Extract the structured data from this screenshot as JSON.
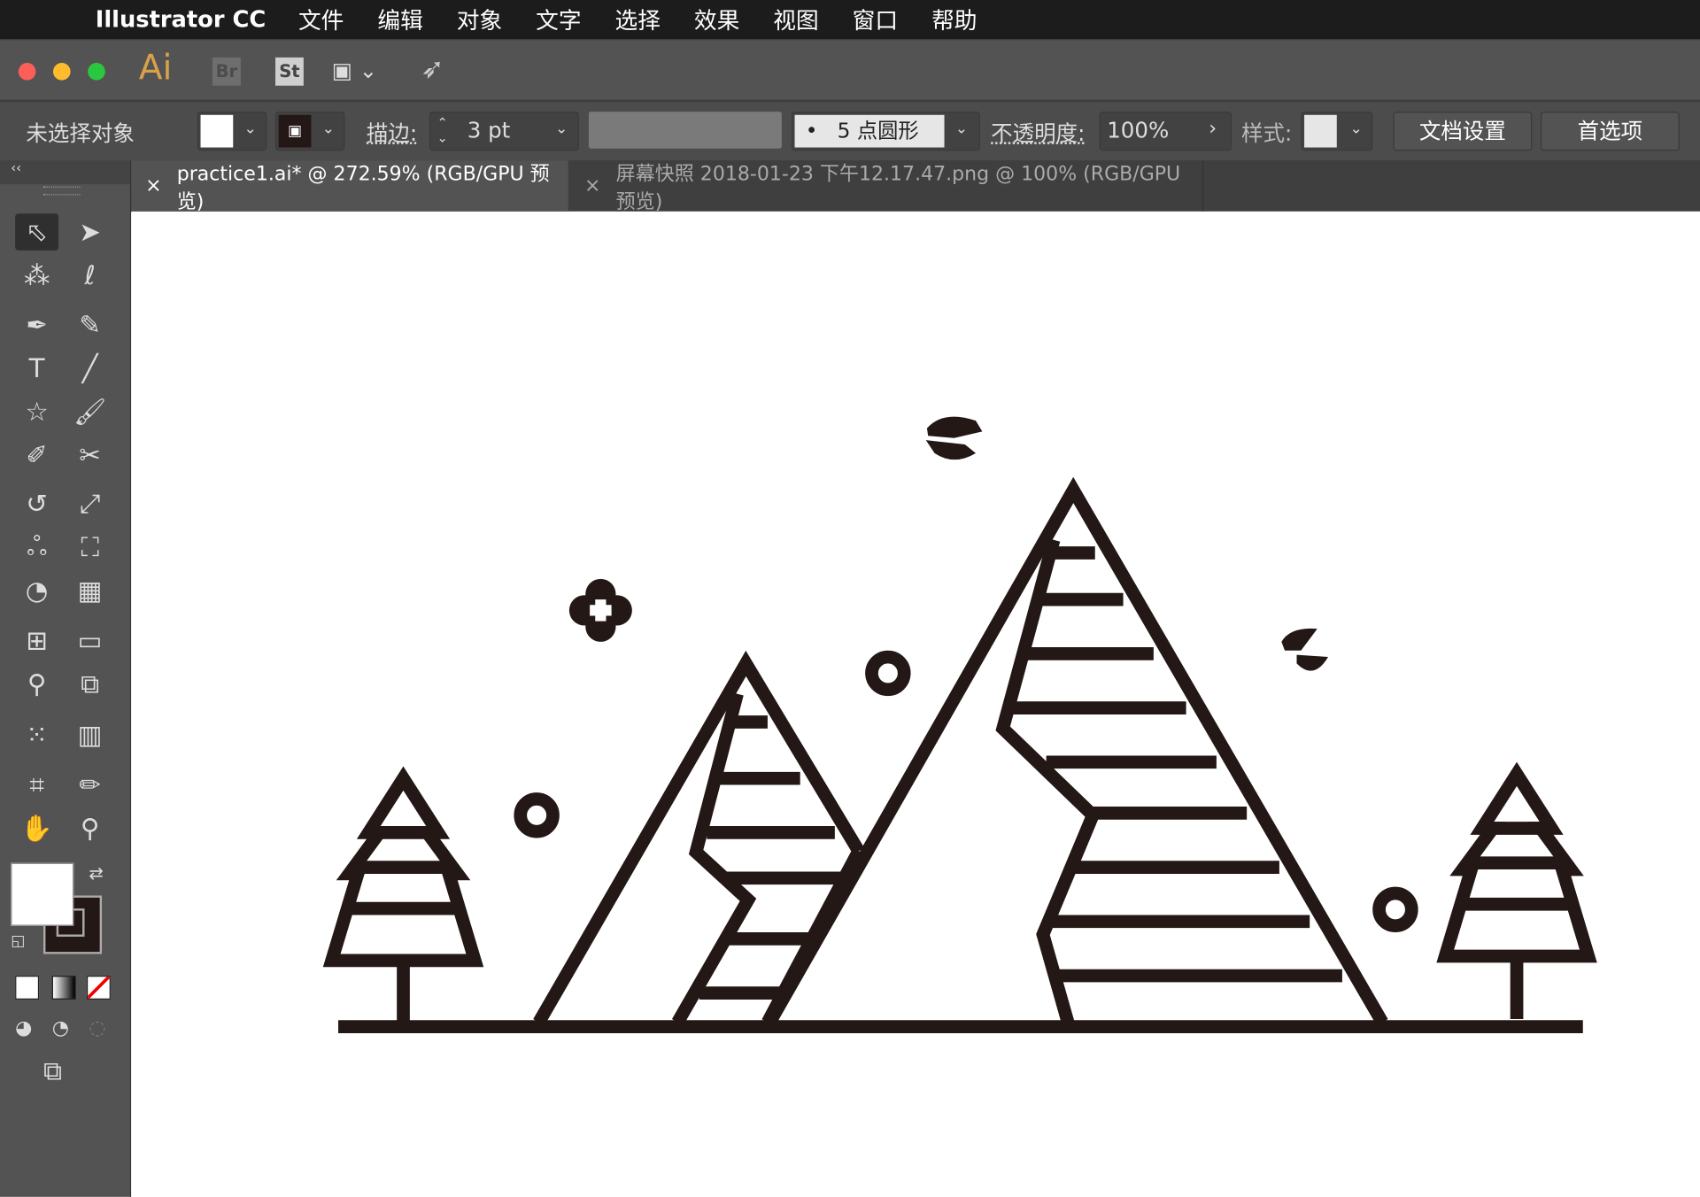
{
  "menubar": {
    "apple": "",
    "app": "Illustrator CC",
    "items": [
      "文件",
      "编辑",
      "对象",
      "文字",
      "选择",
      "效果",
      "视图",
      "窗口",
      "帮助"
    ]
  },
  "appbar": {
    "ai": "Ai",
    "br": "Br",
    "st": "St"
  },
  "control": {
    "selection": "未选择对象",
    "stroke_label": "描边:",
    "stroke_value": "3 pt",
    "brush": "5 点圆形",
    "opacity_label": "不透明度:",
    "opacity_value": "100%",
    "style_label": "样式:",
    "doc_setup": "文档设置",
    "prefs": "首选项"
  },
  "tabs": [
    {
      "close": "×",
      "label": "practice1.ai* @ 272.59% (RGB/GPU 预览)"
    },
    {
      "close": "×",
      "label": "屏幕快照 2018-01-23 下午12.17.47.png @ 100% (RGB/GPU 预览)"
    }
  ],
  "toolbar": {
    "collapse": "‹‹",
    "tools": [
      {
        "name": "selection-tool",
        "g": "⬁"
      },
      {
        "name": "direct-selection-tool",
        "g": "➤"
      },
      {
        "name": "magic-wand-tool",
        "g": "⁂"
      },
      {
        "name": "lasso-tool",
        "g": "ℓ"
      },
      {
        "name": "pen-tool",
        "g": "✒"
      },
      {
        "name": "curvature-tool",
        "g": "✎"
      },
      {
        "name": "type-tool",
        "g": "T"
      },
      {
        "name": "line-tool",
        "g": "╱"
      },
      {
        "name": "star-tool",
        "g": "☆"
      },
      {
        "name": "paintbrush-tool",
        "g": "🖌"
      },
      {
        "name": "shaper-tool",
        "g": "✐"
      },
      {
        "name": "scissors-tool",
        "g": "✂"
      },
      {
        "name": "rotate-tool",
        "g": "↺"
      },
      {
        "name": "scale-tool",
        "g": "⤢"
      },
      {
        "name": "warp-tool",
        "g": "ஃ"
      },
      {
        "name": "free-transform-tool",
        "g": "⛶"
      },
      {
        "name": "shape-builder-tool",
        "g": "◔"
      },
      {
        "name": "perspective-grid-tool",
        "g": "▦"
      },
      {
        "name": "mesh-tool",
        "g": "⊞"
      },
      {
        "name": "gradient-tool",
        "g": "▭"
      },
      {
        "name": "eyedropper-tool",
        "g": "⚲"
      },
      {
        "name": "blend-tool",
        "g": "⧉"
      },
      {
        "name": "symbol-sprayer-tool",
        "g": "⁙"
      },
      {
        "name": "column-graph-tool",
        "g": "▥"
      },
      {
        "name": "artboard-tool",
        "g": "⌗"
      },
      {
        "name": "slice-tool",
        "g": "✏"
      },
      {
        "name": "hand-tool",
        "g": "✋"
      },
      {
        "name": "zoom-tool",
        "g": "⚲"
      }
    ]
  },
  "colors": {
    "ink": "#231815",
    "menubar": "#1c1c1c",
    "panel": "#535353"
  }
}
